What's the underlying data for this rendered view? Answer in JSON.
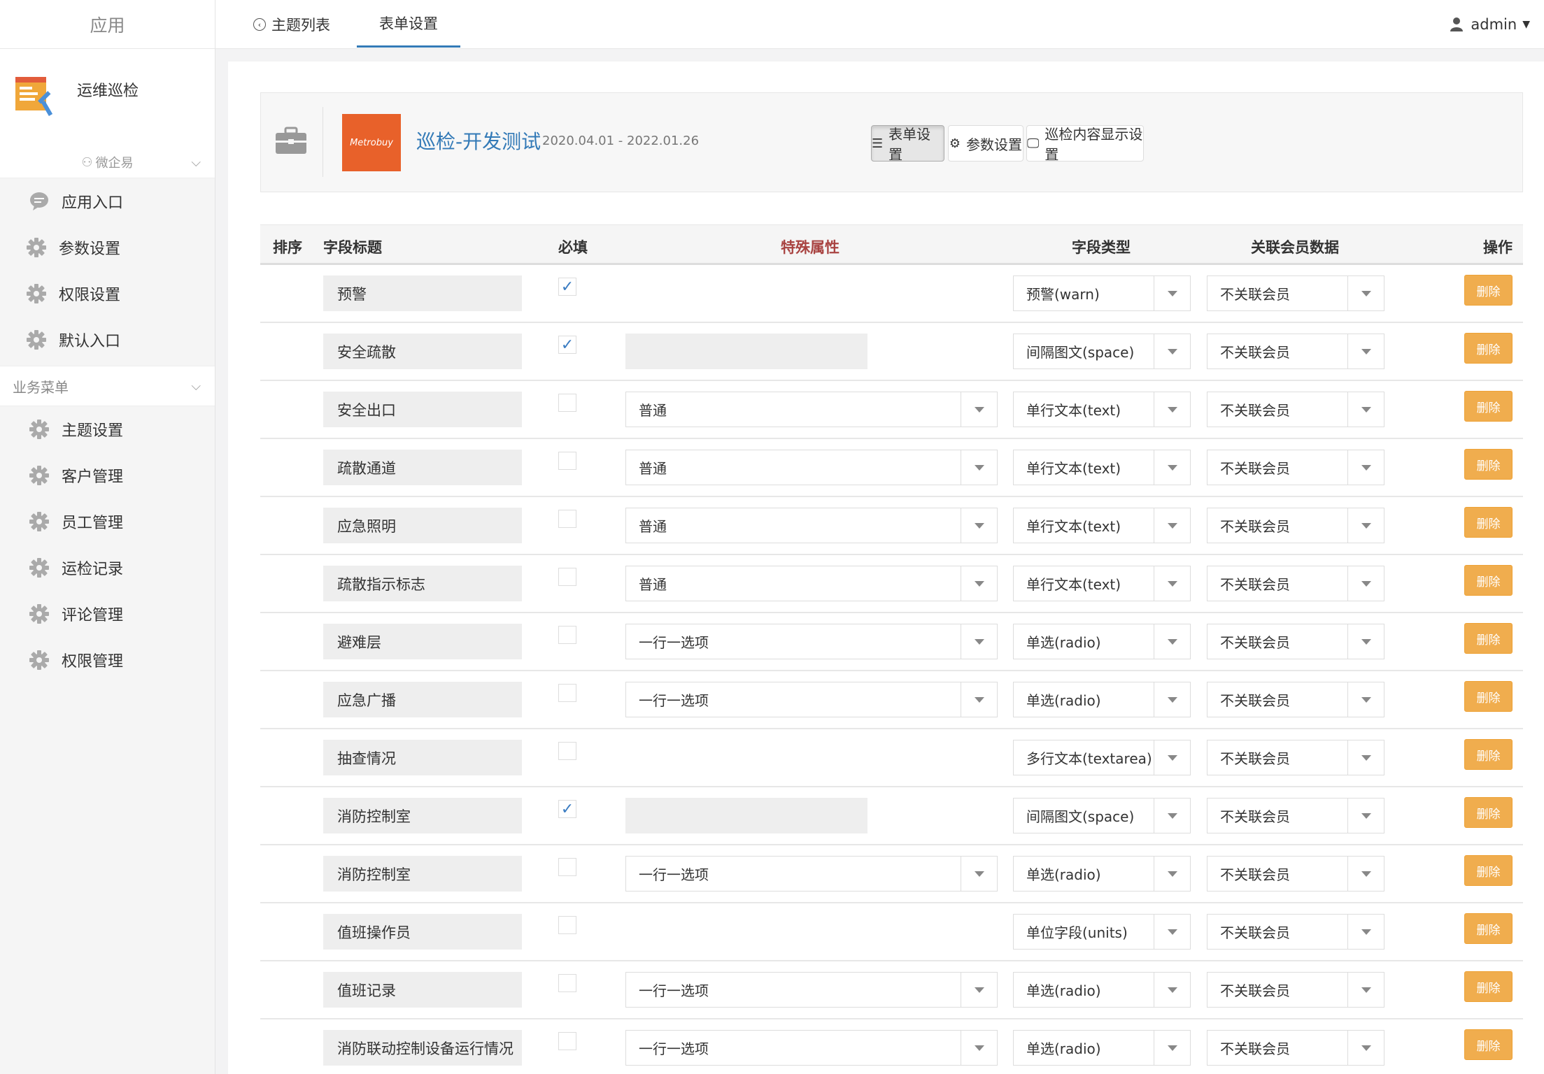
{
  "sidebar": {
    "header": "应用",
    "app_name": "运维巡检",
    "group_label": "微企易",
    "group_items": [
      {
        "label": "应用入口",
        "icon": "chat-icon"
      },
      {
        "label": "参数设置",
        "icon": "gear-icon"
      },
      {
        "label": "权限设置",
        "icon": "gear-icon"
      },
      {
        "label": "默认入口",
        "icon": "gear-icon"
      }
    ],
    "section_label": "业务菜单",
    "section_items": [
      {
        "label": "主题设置",
        "icon": "gear-icon"
      },
      {
        "label": "客户管理",
        "icon": "gear-icon"
      },
      {
        "label": "员工管理",
        "icon": "gear-icon"
      },
      {
        "label": "运检记录",
        "icon": "gear-icon"
      },
      {
        "label": "评论管理",
        "icon": "gear-icon"
      },
      {
        "label": "权限管理",
        "icon": "gear-icon"
      }
    ]
  },
  "topbar": {
    "tab_list": "主题列表",
    "tab_form": "表单设置",
    "user": "admin"
  },
  "header": {
    "thumb_text": "Metrobuy",
    "title": "巡检-开发测试",
    "date_range": "2020.04.01 - 2022.01.26",
    "btn_form": "表单设置",
    "btn_params": "参数设置",
    "btn_display": "巡检内容显示设置"
  },
  "table": {
    "col_order": "排序",
    "col_title": "字段标题",
    "col_required": "必填",
    "col_special": "特殊属性",
    "col_type": "字段类型",
    "col_member": "关联会员数据",
    "col_action": "操作",
    "delete_label": "删除",
    "special_color": "#a94442",
    "rows": [
      {
        "title": "预警",
        "required": true,
        "special": null,
        "type": "预警(warn)",
        "member": "不关联会员"
      },
      {
        "title": "安全疏散",
        "required": true,
        "special": "",
        "type": "间隔图文(space)",
        "member": "不关联会员"
      },
      {
        "title": "安全出口",
        "required": false,
        "special": "普通",
        "type": "单行文本(text)",
        "member": "不关联会员"
      },
      {
        "title": "疏散通道",
        "required": false,
        "special": "普通",
        "type": "单行文本(text)",
        "member": "不关联会员"
      },
      {
        "title": "应急照明",
        "required": false,
        "special": "普通",
        "type": "单行文本(text)",
        "member": "不关联会员"
      },
      {
        "title": "疏散指示标志",
        "required": false,
        "special": "普通",
        "type": "单行文本(text)",
        "member": "不关联会员"
      },
      {
        "title": "避难层",
        "required": false,
        "special": "一行一选项",
        "type": "单选(radio)",
        "member": "不关联会员"
      },
      {
        "title": "应急广播",
        "required": false,
        "special": "一行一选项",
        "type": "单选(radio)",
        "member": "不关联会员"
      },
      {
        "title": "抽查情况",
        "required": false,
        "special": null,
        "type": "多行文本(textarea)",
        "member": "不关联会员"
      },
      {
        "title": "消防控制室",
        "required": true,
        "special": "",
        "type": "间隔图文(space)",
        "member": "不关联会员"
      },
      {
        "title": "消防控制室",
        "required": false,
        "special": "一行一选项",
        "type": "单选(radio)",
        "member": "不关联会员"
      },
      {
        "title": "值班操作员",
        "required": false,
        "special": null,
        "type": "单位字段(units)",
        "member": "不关联会员"
      },
      {
        "title": "值班记录",
        "required": false,
        "special": "一行一选项",
        "type": "单选(radio)",
        "member": "不关联会员"
      },
      {
        "title": "消防联动控制设备运行情况",
        "required": false,
        "special": "一行一选项",
        "type": "单选(radio)",
        "member": "不关联会员"
      }
    ]
  }
}
